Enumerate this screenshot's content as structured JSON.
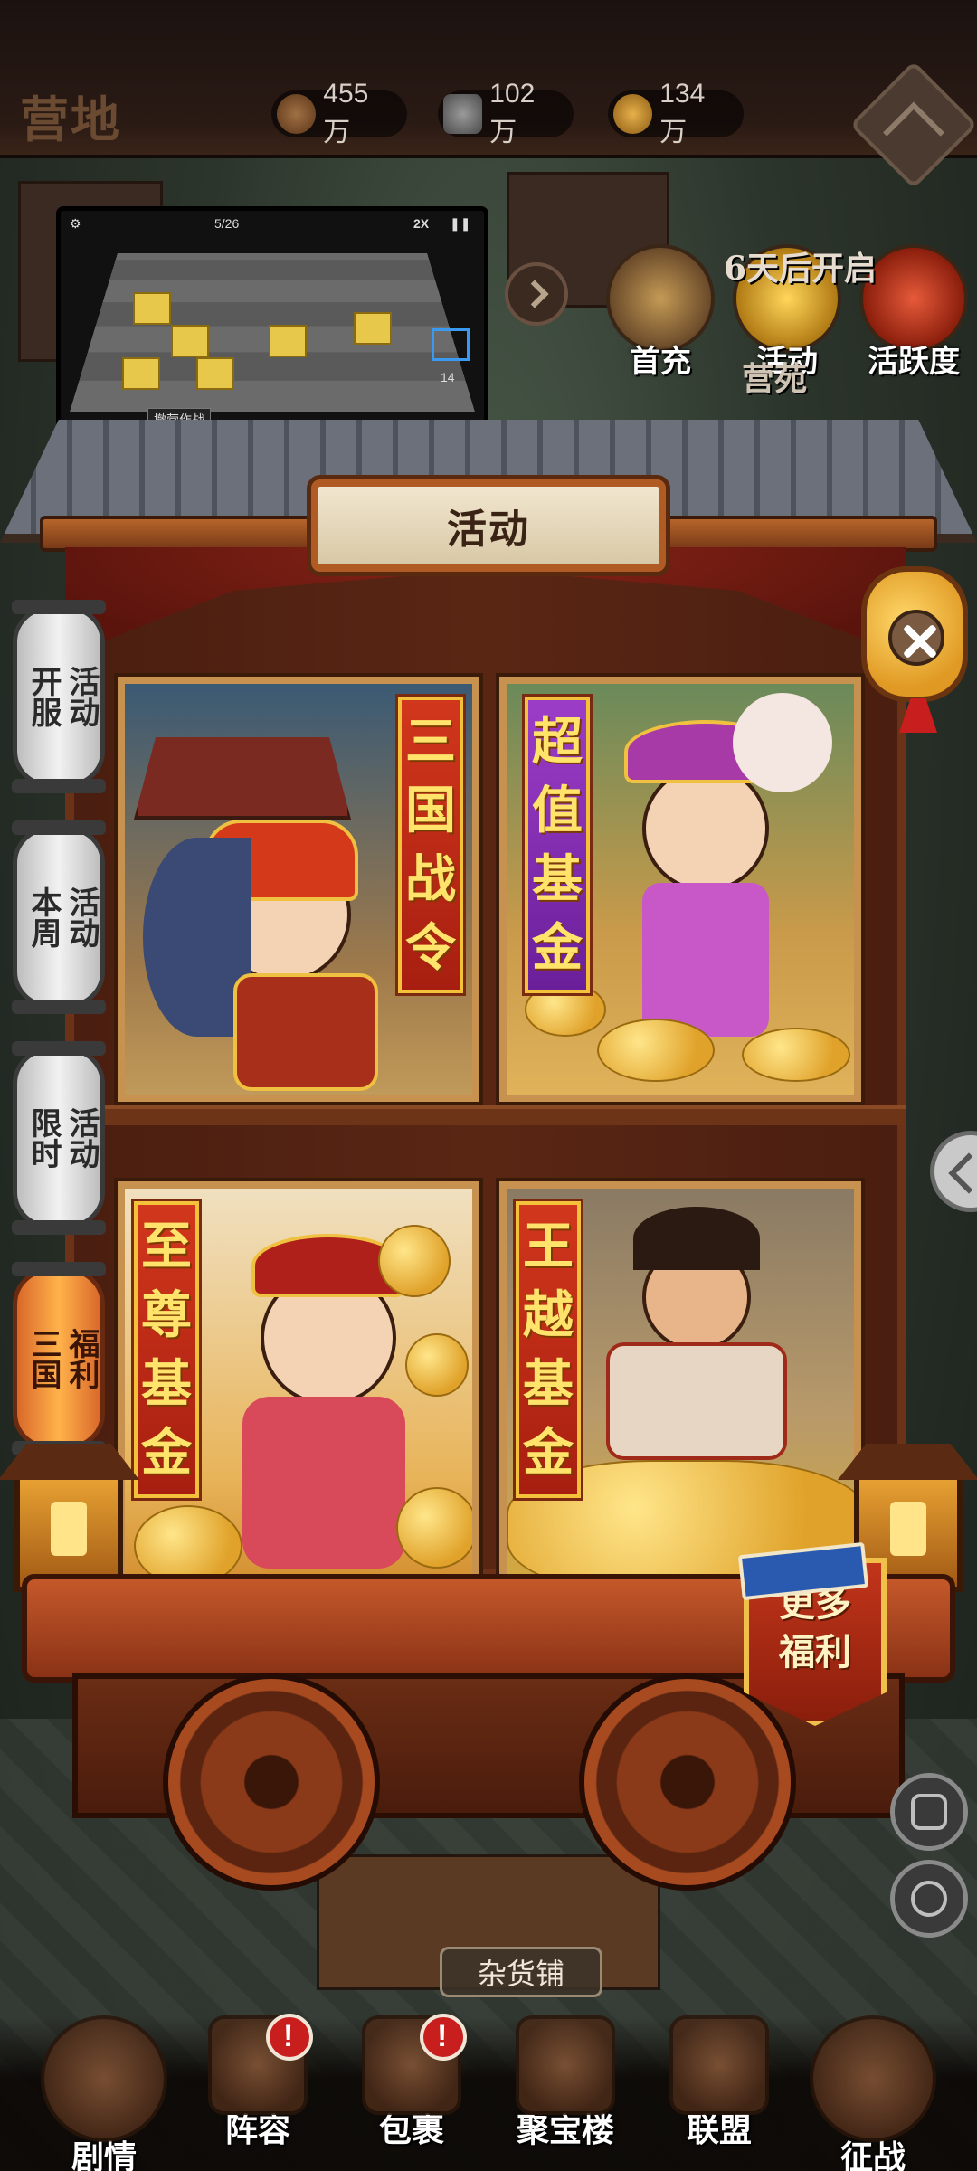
{
  "top_bar": {
    "title": "营地",
    "resources": [
      {
        "icon": "copper-coin-icon",
        "value": "455万"
      },
      {
        "icon": "ore-icon",
        "value": "102万"
      },
      {
        "icon": "grain-icon",
        "value": "134万"
      }
    ]
  },
  "top_right": {
    "items": [
      {
        "label": "首充",
        "icon": "hero-portrait-icon"
      },
      {
        "label": "活动",
        "icon": "gold-ingot-icon"
      },
      {
        "label": "活跃度",
        "icon": "drum-icon"
      }
    ],
    "countdown": "6天后开启",
    "sub_label": "营苑"
  },
  "video": {
    "hud_wave": "5/26",
    "hud_speed": "2X",
    "hud_count": "14",
    "hud_button": "撤营作战"
  },
  "panel": {
    "title": "活动",
    "tabs": [
      {
        "line1": "开服",
        "line2": "活动",
        "active": false
      },
      {
        "line1": "本周",
        "line2": "活动",
        "active": false
      },
      {
        "line1": "限时",
        "line2": "活动",
        "active": false
      },
      {
        "line1": "三国",
        "line2": "福利",
        "active": true
      }
    ],
    "cards": [
      {
        "chars": [
          "三",
          "国",
          "战",
          "令"
        ],
        "color": "red"
      },
      {
        "chars": [
          "超",
          "值",
          "基",
          "金"
        ],
        "color": "purple"
      },
      {
        "chars": [
          "至",
          "尊",
          "基",
          "金"
        ],
        "color": "red"
      },
      {
        "chars": [
          "王",
          "越",
          "基",
          "金"
        ],
        "color": "red"
      }
    ],
    "more_benefits": [
      "更多",
      "福利"
    ]
  },
  "map": {
    "shop_label": "杂货铺"
  },
  "bottom_nav": [
    {
      "label": "剧情",
      "badge": false
    },
    {
      "label": "阵容",
      "badge": true
    },
    {
      "label": "包裹",
      "badge": true
    },
    {
      "label": "聚宝楼",
      "badge": false
    },
    {
      "label": "联盟",
      "badge": false
    },
    {
      "label": "征战",
      "badge": false
    }
  ],
  "colors": {
    "accent_red": "#c81e1e",
    "banner_gold": "#ffe36a",
    "wood": "#6b3218",
    "active_tab": "#ffb24a"
  }
}
